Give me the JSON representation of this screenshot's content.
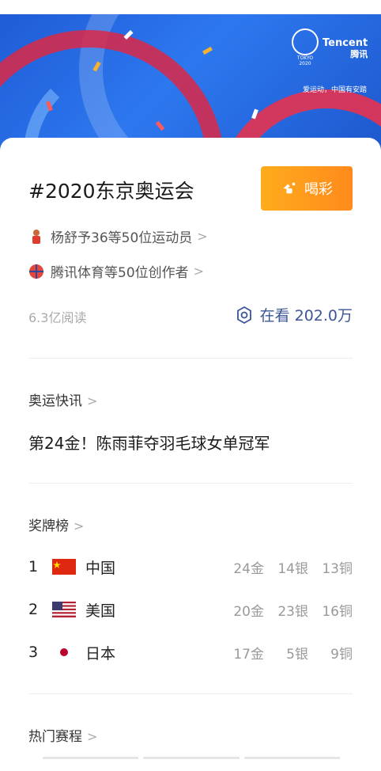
{
  "banner": {
    "logo_text": "TOKYO 2020",
    "brand": "Tencent",
    "brand_cn": "腾讯",
    "slogan": "爱运动，中国有安踏"
  },
  "topic": {
    "title": "#2020东京奥运会",
    "cheer_label": "喝彩",
    "athletes_label": "杨舒予36等50位运动员",
    "creators_label": "腾讯体育等50位创作者",
    "reads": "6.3亿阅读",
    "watching": "在看 202.0万"
  },
  "news": {
    "section_label": "奥运快讯",
    "headline": "第24金！陈雨菲夺羽毛球女单冠军"
  },
  "medals": {
    "section_label": "奖牌榜",
    "rows": [
      {
        "rank": "1",
        "country": "中国",
        "gold": "24金",
        "silver": "14银",
        "bronze": "13铜"
      },
      {
        "rank": "2",
        "country": "美国",
        "gold": "20金",
        "silver": "23银",
        "bronze": "16铜"
      },
      {
        "rank": "3",
        "country": "日本",
        "gold": "17金",
        "silver": "5银",
        "bronze": "9铜"
      }
    ]
  },
  "schedule": {
    "section_label": "热门赛程"
  },
  "colors": {
    "accent_orange": "#ff9a1c",
    "watch_blue": "#3b5596",
    "banner_blue": "#2d78ef"
  }
}
